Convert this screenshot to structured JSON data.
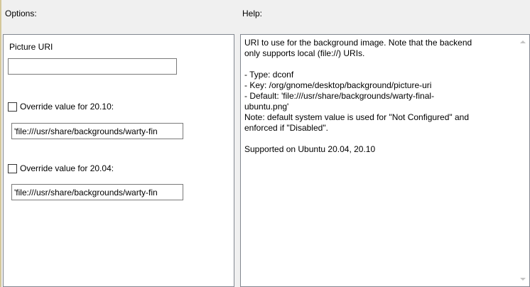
{
  "options_label": "Options:",
  "help_label": "Help:",
  "options": {
    "picture_uri_label": "Picture URI",
    "picture_uri_value": "",
    "override_2010_label": "Override value for 20.10:",
    "override_2010_checked": false,
    "override_2010_value": "'file:///usr/share/backgrounds/warty-fin",
    "override_2004_label": "Override value for 20.04:",
    "override_2004_checked": false,
    "override_2004_value": "'file:///usr/share/backgrounds/warty-fin"
  },
  "help": {
    "lines": [
      "URI to use for the background image. Note that the backend",
      "only supports local (file://) URIs.",
      "",
      "- Type: dconf",
      "- Key: /org/gnome/desktop/background/picture-uri",
      "- Default: 'file:///usr/share/backgrounds/warty-final-",
      "ubuntu.png'",
      "Note: default system value is used for \"Not Configured\" and",
      "enforced if \"Disabled\".",
      "",
      "Supported on Ubuntu 20.04, 20.10"
    ]
  }
}
